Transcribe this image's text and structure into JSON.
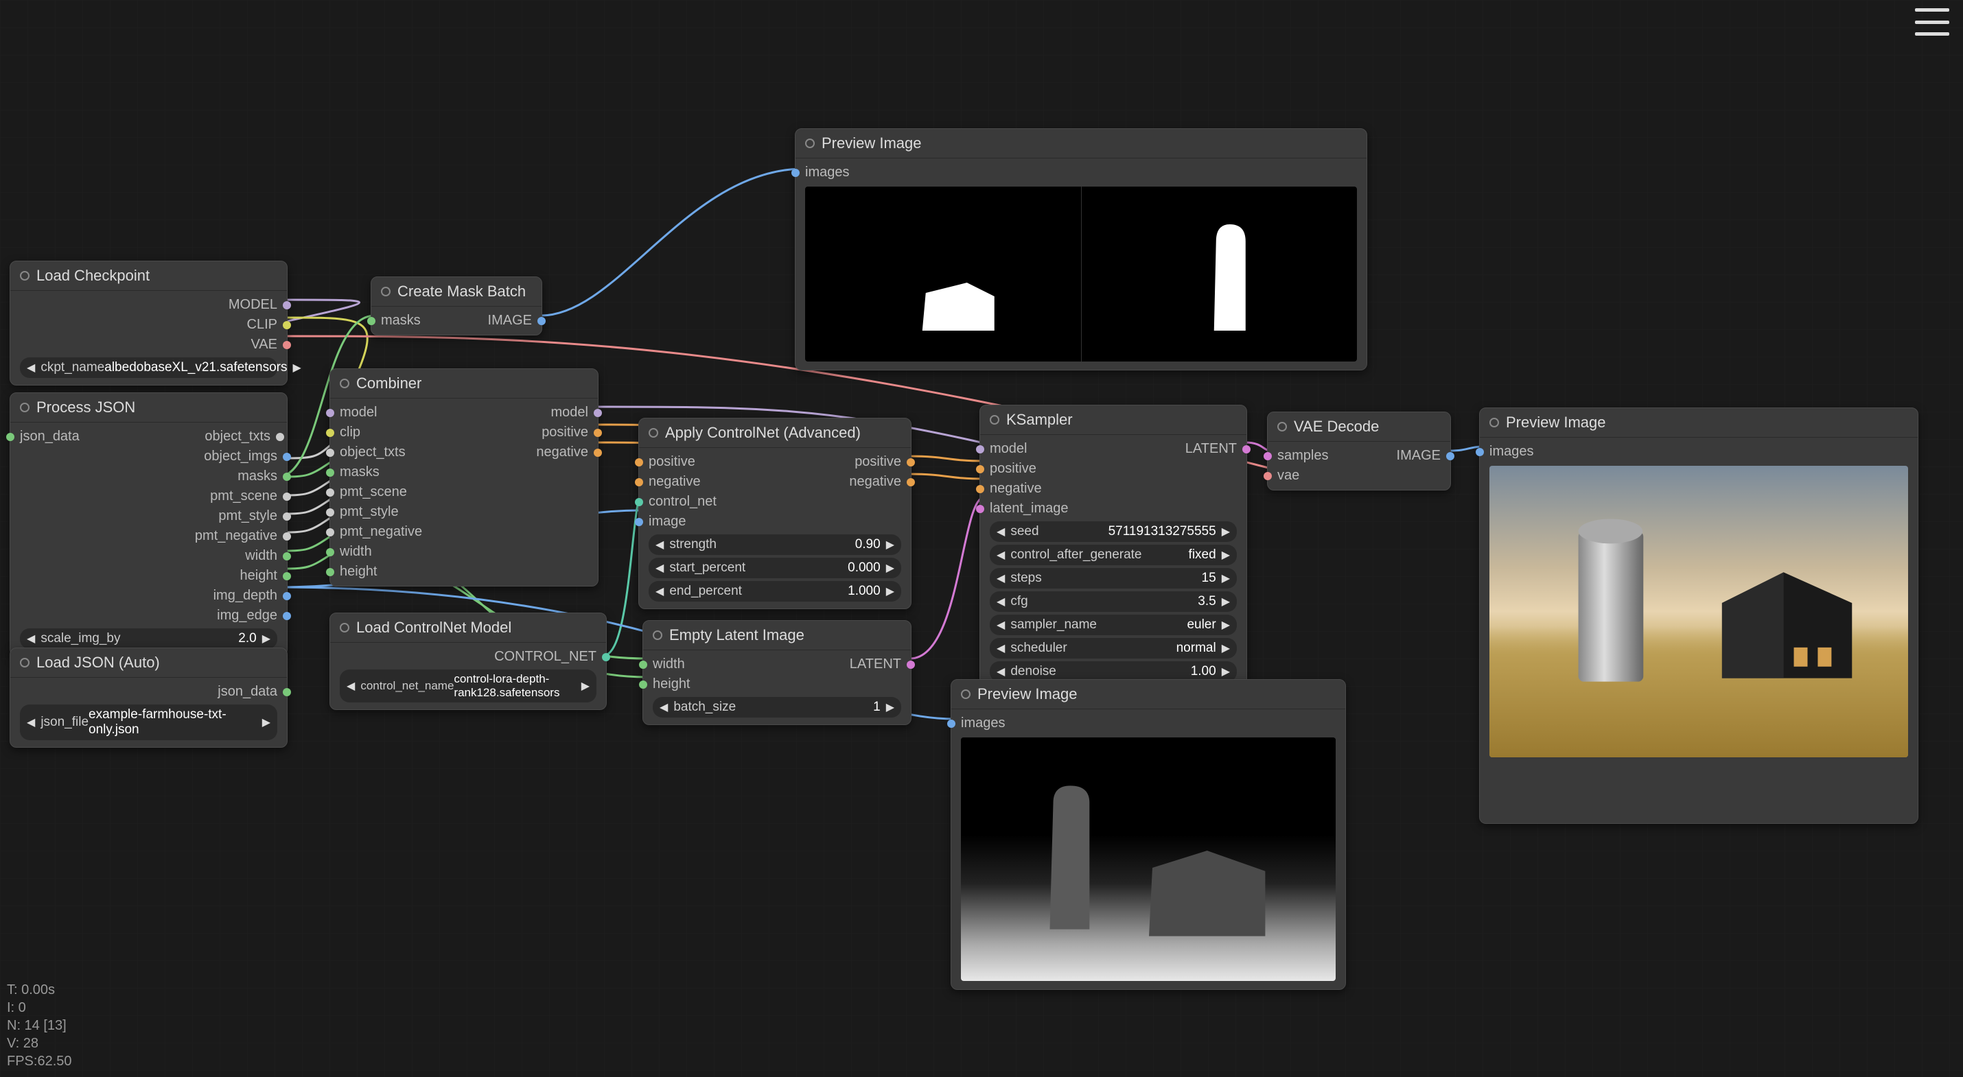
{
  "stats": {
    "t": "T: 0.00s",
    "i": "I: 0",
    "n": "N: 14 [13]",
    "v": "V: 28",
    "fps": "FPS:62.50"
  },
  "nodes": {
    "load_checkpoint": {
      "title": "Load Checkpoint",
      "outputs": [
        "MODEL",
        "CLIP",
        "VAE"
      ],
      "ckpt_label": "ckpt_name",
      "ckpt_value": "albedobaseXL_v21.safetensors"
    },
    "process_json": {
      "title": "Process JSON",
      "inputs": [
        "json_data"
      ],
      "outputs": [
        "object_txts",
        "object_imgs",
        "masks",
        "pmt_scene",
        "pmt_style",
        "pmt_negative",
        "width",
        "height",
        "img_depth",
        "img_edge"
      ],
      "scale_label": "scale_img_by",
      "scale_value": "2.0"
    },
    "load_json": {
      "title": "Load JSON (Auto)",
      "outputs": [
        "json_data"
      ],
      "file_label": "json_file",
      "file_value": "example-farmhouse-txt-only.json"
    },
    "create_mask": {
      "title": "Create Mask Batch",
      "inputs": [
        "masks"
      ],
      "outputs": [
        "IMAGE"
      ]
    },
    "combiner": {
      "title": "Combiner",
      "inputs": [
        "model",
        "clip",
        "object_txts",
        "masks",
        "pmt_scene",
        "pmt_style",
        "pmt_negative",
        "width",
        "height"
      ],
      "outputs": [
        "model",
        "positive",
        "negative"
      ]
    },
    "load_controlnet": {
      "title": "Load ControlNet Model",
      "outputs": [
        "CONTROL_NET"
      ],
      "name_label": "control_net_name",
      "name_value": "control-lora-depth-rank128.safetensors"
    },
    "apply_controlnet": {
      "title": "Apply ControlNet (Advanced)",
      "inputs": [
        "positive",
        "negative",
        "control_net",
        "image"
      ],
      "outputs": [
        "positive",
        "negative"
      ],
      "widgets": [
        {
          "label": "strength",
          "value": "0.90"
        },
        {
          "label": "start_percent",
          "value": "0.000"
        },
        {
          "label": "end_percent",
          "value": "1.000"
        }
      ]
    },
    "empty_latent": {
      "title": "Empty Latent Image",
      "inputs": [
        "width",
        "height"
      ],
      "outputs": [
        "LATENT"
      ],
      "batch_label": "batch_size",
      "batch_value": "1"
    },
    "ksampler": {
      "title": "KSampler",
      "inputs": [
        "model",
        "positive",
        "negative",
        "latent_image"
      ],
      "outputs": [
        "LATENT"
      ],
      "widgets": [
        {
          "label": "seed",
          "value": "571191313275555"
        },
        {
          "label": "control_after_generate",
          "value": "fixed"
        },
        {
          "label": "steps",
          "value": "15"
        },
        {
          "label": "cfg",
          "value": "3.5"
        },
        {
          "label": "sampler_name",
          "value": "euler"
        },
        {
          "label": "scheduler",
          "value": "normal"
        },
        {
          "label": "denoise",
          "value": "1.00"
        }
      ]
    },
    "vae_decode": {
      "title": "VAE Decode",
      "inputs": [
        "samples",
        "vae"
      ],
      "outputs": [
        "IMAGE"
      ]
    },
    "preview1": {
      "title": "Preview Image",
      "inputs": [
        "images"
      ]
    },
    "preview2": {
      "title": "Preview Image",
      "inputs": [
        "images"
      ]
    },
    "preview3": {
      "title": "Preview Image",
      "inputs": [
        "images"
      ]
    }
  }
}
